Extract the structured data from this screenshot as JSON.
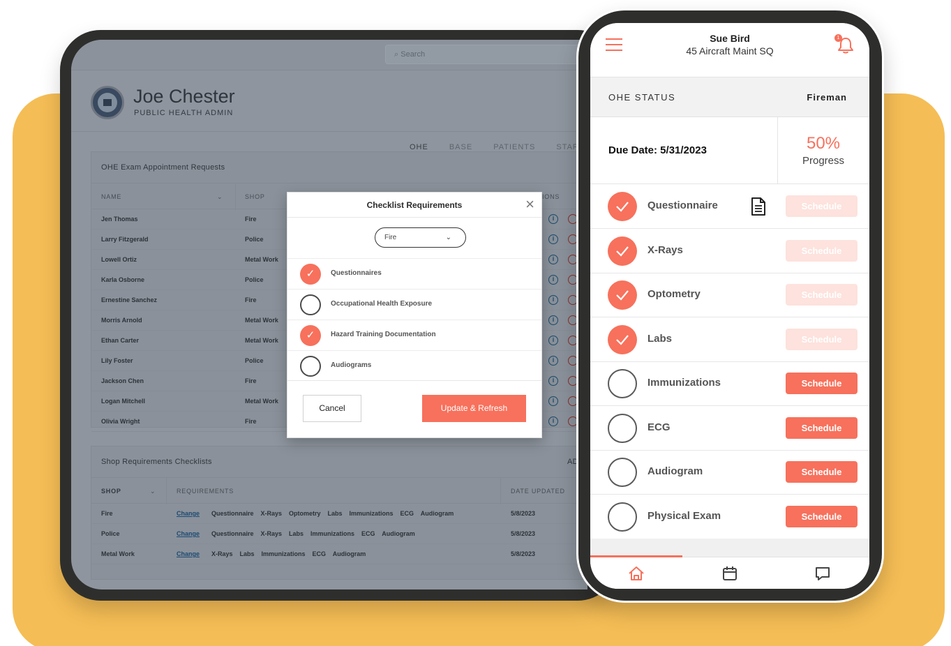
{
  "tablet": {
    "search_placeholder": "Search",
    "user_name": "Joe Chester",
    "user_role": "PUBLIC HEALTH ADMIN",
    "tabs": [
      "OHE",
      "BASE",
      "PATIENTS",
      "STAF"
    ],
    "requests_title": "OHE Exam Appointment Requests",
    "requests_headers": {
      "name": "NAME",
      "shop": "SHOP",
      "actions": "IONS"
    },
    "requests": [
      {
        "name": "Jen Thomas",
        "shop": "Fire"
      },
      {
        "name": "Larry Fitzgerald",
        "shop": "Police"
      },
      {
        "name": "Lowell Ortiz",
        "shop": "Metal Work"
      },
      {
        "name": "Karla Osborne",
        "shop": "Police"
      },
      {
        "name": "Ernestine Sanchez",
        "shop": "Fire"
      },
      {
        "name": "Morris Arnold",
        "shop": "Metal Work"
      },
      {
        "name": "Ethan Carter",
        "shop": "Metal Work"
      },
      {
        "name": "Lily Foster",
        "shop": "Police"
      },
      {
        "name": "Jackson Chen",
        "shop": "Fire"
      },
      {
        "name": "Logan Mitchell",
        "shop": "Metal Work"
      },
      {
        "name": "Olivia Wright",
        "shop": "Fire"
      }
    ],
    "shop_title": "Shop Requirements Checklists",
    "shop_add": "AD",
    "shop_headers": {
      "shop": "SHOP",
      "requirements": "REQUIREMENTS",
      "date": "DATE UPDATED"
    },
    "shops": [
      {
        "shop": "Fire",
        "change": "Change",
        "reqs": "Questionnaire    X-Rays    Optometry    Labs    Immunizations    ECG    Audiogram",
        "date": "5/8/2023"
      },
      {
        "shop": "Police",
        "change": "Change",
        "reqs": "Questionnaire    X-Rays    Labs    Immunizations    ECG    Audiogram",
        "date": "5/8/2023"
      },
      {
        "shop": "Metal Work",
        "change": "Change",
        "reqs": "X-Rays    Labs    Immunizations    ECG    Audiogram",
        "date": "5/8/2023"
      }
    ]
  },
  "modal": {
    "title": "Checklist Requirements",
    "close": "×",
    "selected_shop": "Fire",
    "items": [
      {
        "label": "Questionnaires",
        "checked": true
      },
      {
        "label": "Occupational Health Exposure",
        "checked": false
      },
      {
        "label": "Hazard Training Documentation",
        "checked": true
      },
      {
        "label": "Audiograms",
        "checked": false
      }
    ],
    "cancel_label": "Cancel",
    "update_label": "Update & Refresh"
  },
  "phone": {
    "name": "Sue Bird",
    "unit": "45 Aircraft Maint SQ",
    "notification_count": "1",
    "status_label": "OHE STATUS",
    "status_value": "Fireman",
    "due_date": "Due Date: 5/31/2023",
    "progress_pct": "50%",
    "progress_label": "Progress",
    "progress_value": 0.5,
    "items": [
      {
        "label": "Questionnaire",
        "done": true,
        "button": "Schedule",
        "doc_icon": true
      },
      {
        "label": "X-Rays",
        "done": true,
        "button": "Schedule"
      },
      {
        "label": "Optometry",
        "done": true,
        "button": "Schedule"
      },
      {
        "label": "Labs",
        "done": true,
        "button": "Schedule"
      },
      {
        "label": "Immunizations",
        "done": false,
        "button": "Schedule"
      },
      {
        "label": "ECG",
        "done": false,
        "button": "Schedule"
      },
      {
        "label": "Audiogram",
        "done": false,
        "button": "Schedule"
      },
      {
        "label": "Physical Exam",
        "done": false,
        "button": "Schedule"
      }
    ],
    "nav": [
      "home-icon",
      "calendar-icon",
      "chat-icon"
    ]
  },
  "colors": {
    "accent": "#f7715c",
    "background": "#f5bd55",
    "device": "#2e2f2d"
  }
}
